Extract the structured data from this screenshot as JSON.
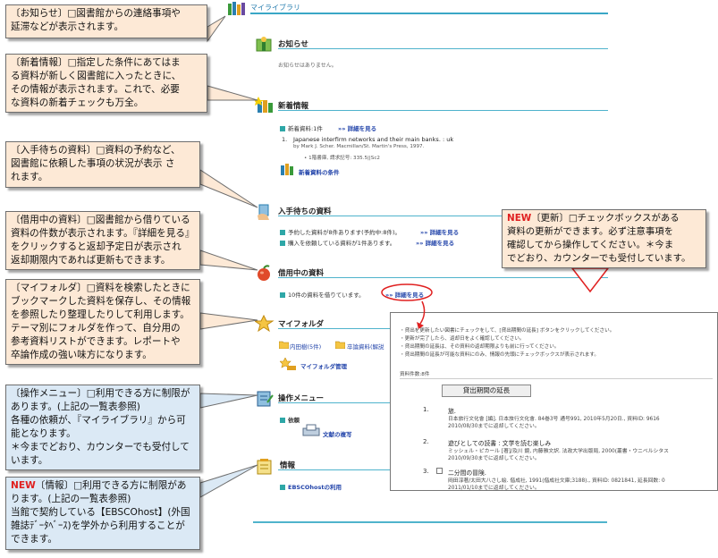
{
  "header": {
    "title": "マイライブラリ"
  },
  "sections": {
    "oshirase": {
      "title": "お知らせ",
      "empty": "お知らせはありません。"
    },
    "shinchaku": {
      "title": "新着情報",
      "count": "新着資料:1件",
      "detail_link": "詳細を見る",
      "item_num": "1.",
      "item_title": "Japanese interfirm networks and their main banks. : uk",
      "item_by": "by Mark J. Scher. Macmillan/St. Martin's Press, 1997.",
      "item_loc": "1階書庫, 請求記号: 335.5||Sc2",
      "condition_link": "新着資料の条件"
    },
    "machi": {
      "title": "入手待ちの資料",
      "line1": "予約した資料が8件あります(予約中:8件)。",
      "line2": "購入を依頼している資料が1件あります。",
      "detail_link": "詳細を見る"
    },
    "kashidashi": {
      "title": "借用中の資料",
      "line": "10件の資料を借りています。",
      "detail_link": "詳細を見る"
    },
    "folder": {
      "title": "マイフォルダ",
      "folder1": "内田樹(5件)",
      "folder2": "卒論資料(解説",
      "manage_link": "マイフォルダ管理"
    },
    "menu": {
      "title": "操作メニュー",
      "group": "依頼",
      "item": "文献の複写"
    },
    "joho": {
      "title": "情報",
      "item": "EBSCOhostの利用"
    }
  },
  "popup": {
    "notes": [
      "・貸出を更新したい図書にチェックをして、[貸出期間の延長] ボタンをクリックしてください。",
      "・更新が完了したら、返却日をよく確認してください。",
      "・貸出期間の延長は、その資料の返却期限よりも前に行ってください。",
      "・貸出期間の延長が可能な資料にのみ、情報の先頭にチェックボックスが表示されます。"
    ],
    "count": "資料件数:8件",
    "button": "貸出期間の延長",
    "items": [
      {
        "num": "1.",
        "title": "旅.",
        "line1": "日本旅行文化會 [編]. 日本旅行文化會. 84巻3号 通号991, 2010年5月20日., 資料ID: 9616",
        "line2": "2010/08/30までに返却してください。"
      },
      {
        "num": "2.",
        "title": "遊びとしての読書 : 文学を読む楽しみ",
        "line1": "ミッシェル・ピカール [著]/及川 鏡, 内藤雅文訳. 法政大学出版局, 2000(叢書・ウニベルシタス",
        "line2": "2010/09/30までに返却してください。"
      },
      {
        "num": "3.",
        "title": "二分間の冒険.",
        "line1": "岡田淳著/太田大八さし絵. 偕成社, 1991(偕成社文庫;3188)., 資料ID: 0821841, 延長回数: 0",
        "line2": "2011/01/10までに返却してください。"
      }
    ]
  },
  "callouts": {
    "c1": {
      "tag": "〔お知らせ〕",
      "text1": "□図書館からの連絡事項や",
      "text2": "延滞などが表示されます。"
    },
    "c2": {
      "tag": "〔新着情報〕",
      "text1": "□指定した条件にあてはま",
      "text2": "る資料が新しく図書館に入ったときに、",
      "text3": "その情報が表示されます。これで、必要",
      "text4": "な資料の新着チェックも万全。"
    },
    "c3": {
      "tag": "〔入手待ちの資料〕",
      "text1": "□資料の予約など、",
      "text2": "図書館に依頼した事項の状況が表示 さ",
      "text3": "れます。"
    },
    "c4": {
      "tag": "〔借用中の資料〕",
      "text1": "□図書館から借りている",
      "text2": "資料の件数が表示されます。『詳細を見る』",
      "text3": "をクリックすると返却予定日が表示され",
      "text4": "返却期限内であれば更新もできます。"
    },
    "c5": {
      "tag": "〔マイフォルダ〕",
      "text1": "□資料を検索したときに",
      "text2": "ブックマークした資料を保存し、その情報",
      "text3": "を参照したり整理したりして利用します。",
      "text4": "テーマ別にフォルダを作って、自分用の",
      "text5": "参考資料リストができます。レポートや",
      "text6": "卒論作成の強い味方になります。"
    },
    "c6": {
      "tag": "〔操作メニュー〕",
      "text1": "□利用できる方に制限が",
      "text2": "あります。(上記の一覧表参照)",
      "text3": "各種の依頼が、『マイライブラリ』から可",
      "text4": "能となります。",
      "text5": "＊今までどおり、カウンターでも受付して",
      "text6": "います。"
    },
    "c7": {
      "new": "NEW",
      "tag": "〔情報〕",
      "text1": "□利用できる方に制限があ",
      "text2": "ります。(上記の一覧表参照)",
      "text3": "当館で契約している【EBSCOhost】(外国",
      "text4": "雑誌ﾃﾞｰﾀﾍﾞｰｽ)を学外から利用することが",
      "text5": "できます。"
    },
    "c8": {
      "new": "NEW",
      "tag": "〔更新〕",
      "text1": "□チェックボックスがある",
      "text2": "資料の更新ができます。必ず注意事項を",
      "text3": "確認してから操作してください。＊今ま",
      "text4": "でどおり、カウンターでも受付しています。"
    }
  }
}
